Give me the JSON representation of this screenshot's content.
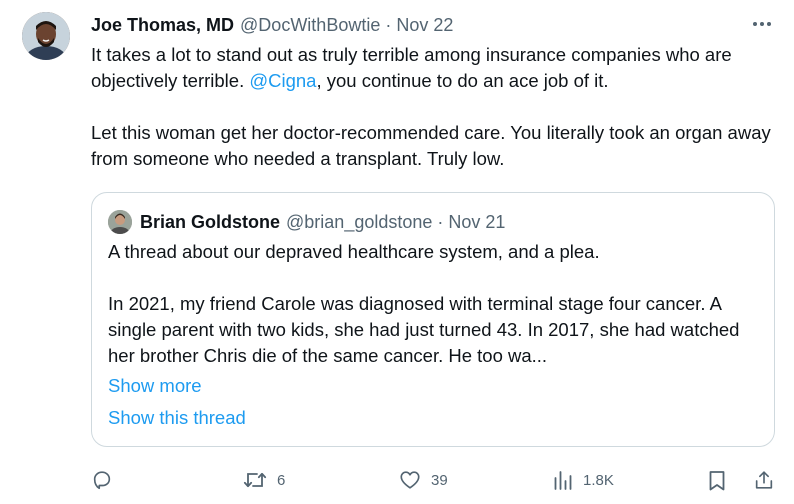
{
  "tweet": {
    "author_name": "Joe Thomas, MD",
    "author_handle": "@DocWithBowtie",
    "separator": "·",
    "date": "Nov 22",
    "more_label": "···",
    "text_line1_before": "It takes a lot to stand out as truly terrible among insurance companies who are objectively terrible. ",
    "mention": "@Cigna",
    "text_line1_after": ", you continue to do an ace job of it.",
    "text_para2": "Let this woman get her doctor-recommended care. You literally took an organ away from someone who needed a transplant. Truly low."
  },
  "quote": {
    "author_name": "Brian Goldstone",
    "author_handle": "@brian_goldstone",
    "separator": "·",
    "date": "Nov 21",
    "para1": "A thread about our depraved healthcare system, and a plea.",
    "para2": "In 2021, my friend Carole was diagnosed with terminal stage four cancer. A single parent with two kids, she had just turned 43. In 2017, she had watched her brother Chris die of the same cancer. He too wa...",
    "show_more": "Show more",
    "show_thread": "Show this thread"
  },
  "actions": {
    "reply_count": "",
    "retweet_count": "6",
    "like_count": "39",
    "views_count": "1.8K"
  },
  "colors": {
    "link": "#1d9bf0",
    "text": "#0f1419",
    "muted": "#536471",
    "border": "#cfd9de"
  }
}
